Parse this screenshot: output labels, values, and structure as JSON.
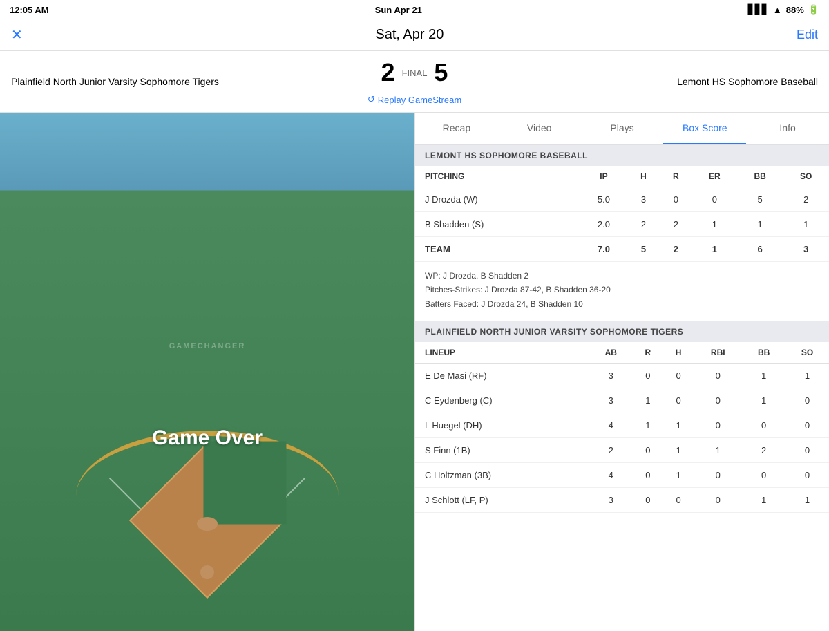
{
  "statusBar": {
    "time": "12:05 AM",
    "day": "Sun Apr 21",
    "battery": "88%"
  },
  "header": {
    "closeLabel": "✕",
    "title": "Sat, Apr 20",
    "editLabel": "Edit"
  },
  "scoreRow": {
    "teamLeft": "Plainfield North Junior Varsity Sophomore Tigers",
    "scoreLeft": "2",
    "status": "FINAL",
    "scoreRight": "5",
    "teamRight": "Lemont HS Sophomore Baseball",
    "replayLabel": "Replay GameStream"
  },
  "tabs": [
    {
      "id": "recap",
      "label": "Recap",
      "active": false
    },
    {
      "id": "video",
      "label": "Video",
      "active": false
    },
    {
      "id": "plays",
      "label": "Plays",
      "active": false
    },
    {
      "id": "boxscore",
      "label": "Box Score",
      "active": true
    },
    {
      "id": "info",
      "label": "Info",
      "active": false
    }
  ],
  "field": {
    "watermark": "GAMECHANGER",
    "gameOverText": "Game Over"
  },
  "boxScore": {
    "lemont": {
      "sectionTitle": "LEMONT HS SOPHOMORE BASEBALL",
      "pitching": {
        "headers": [
          "PITCHING",
          "IP",
          "H",
          "R",
          "ER",
          "BB",
          "SO"
        ],
        "rows": [
          {
            "name": "J Drozda (W)",
            "ip": "5.0",
            "h": "3",
            "r": "0",
            "er": "0",
            "bb": "5",
            "so": "2"
          },
          {
            "name": "B Shadden (S)",
            "ip": "2.0",
            "h": "2",
            "r": "2",
            "er": "1",
            "bb": "1",
            "so": "1"
          },
          {
            "name": "TEAM",
            "ip": "7.0",
            "h": "5",
            "r": "2",
            "er": "1",
            "bb": "6",
            "so": "3"
          }
        ],
        "notes": {
          "wp": "WP: J Drozda, B Shadden 2",
          "pitches": "Pitches-Strikes: J Drozda 87-42, B Shadden 36-20",
          "batters": "Batters Faced: J Drozda 24, B Shadden 10"
        }
      }
    },
    "plainfield": {
      "sectionTitle": "PLAINFIELD NORTH JUNIOR VARSITY SOPHOMORE TIGERS",
      "lineup": {
        "headers": [
          "LINEUP",
          "AB",
          "R",
          "H",
          "RBI",
          "BB",
          "SO"
        ],
        "rows": [
          {
            "name": "E De Masi (RF)",
            "ab": "3",
            "r": "0",
            "h": "0",
            "rbi": "0",
            "bb": "1",
            "so": "1"
          },
          {
            "name": "C Eydenberg (C)",
            "ab": "3",
            "r": "1",
            "h": "0",
            "rbi": "0",
            "bb": "1",
            "so": "0"
          },
          {
            "name": "L Huegel (DH)",
            "ab": "4",
            "r": "1",
            "h": "1",
            "rbi": "0",
            "bb": "0",
            "so": "0"
          },
          {
            "name": "S Finn (1B)",
            "ab": "2",
            "r": "0",
            "h": "1",
            "rbi": "1",
            "bb": "2",
            "so": "0"
          },
          {
            "name": "C Holtzman (3B)",
            "ab": "4",
            "r": "0",
            "h": "1",
            "rbi": "0",
            "bb": "0",
            "so": "0"
          },
          {
            "name": "J Schlott (LF, P)",
            "ab": "3",
            "r": "0",
            "h": "0",
            "rbi": "0",
            "bb": "1",
            "so": "1"
          }
        ]
      }
    }
  }
}
